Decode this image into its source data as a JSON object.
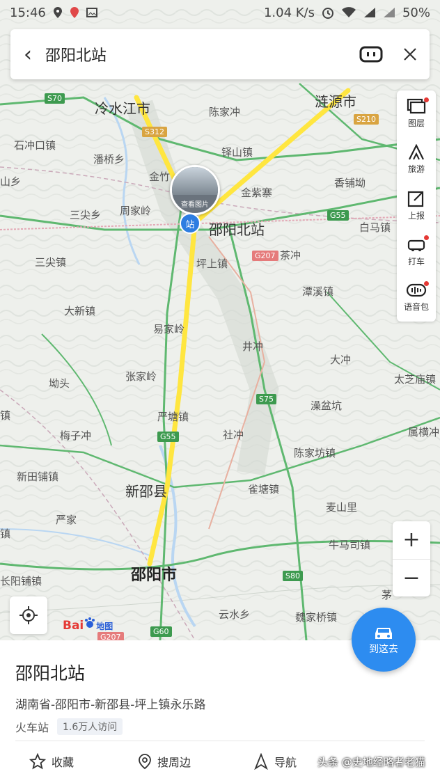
{
  "status_bar": {
    "time": "15:46",
    "net_speed": "1.04 K/s",
    "battery": "50%"
  },
  "search": {
    "title": "邵阳北站"
  },
  "map_labels": [
    {
      "id": "lengshuijiang",
      "text": "冷水江市",
      "cls": "big"
    },
    {
      "id": "lianyuan",
      "text": "涟源市",
      "cls": "big"
    },
    {
      "id": "chenjiachong",
      "text": "陈家冲",
      "cls": ""
    },
    {
      "id": "shichongkou",
      "text": "石冲口镇",
      "cls": ""
    },
    {
      "id": "panqiao",
      "text": "潘桥乡",
      "cls": ""
    },
    {
      "id": "dushanzhen",
      "text": "铎山镇",
      "cls": ""
    },
    {
      "id": "jinzhu",
      "text": "金竹",
      "cls": ""
    },
    {
      "id": "jinzizhai",
      "text": "金紫寨",
      "cls": ""
    },
    {
      "id": "xiangpuwu",
      "text": "香铺坳",
      "cls": ""
    },
    {
      "id": "xiang_left",
      "text": "山乡",
      "cls": ""
    },
    {
      "id": "sanjianxiang",
      "text": "三尖乡",
      "cls": ""
    },
    {
      "id": "zhoujialing",
      "text": "周家岭",
      "cls": ""
    },
    {
      "id": "shaoyangbei",
      "text": "邵阳北站",
      "cls": "big"
    },
    {
      "id": "baimazhen",
      "text": "白马镇",
      "cls": ""
    },
    {
      "id": "sanjianzhen",
      "text": "三尖镇",
      "cls": ""
    },
    {
      "id": "pingshangzhen",
      "text": "坪上镇",
      "cls": ""
    },
    {
      "id": "chachong",
      "text": "茶冲",
      "cls": ""
    },
    {
      "id": "tanxizhen",
      "text": "潭溪镇",
      "cls": ""
    },
    {
      "id": "daxinzhen",
      "text": "大新镇",
      "cls": ""
    },
    {
      "id": "yijialing",
      "text": "易家岭",
      "cls": ""
    },
    {
      "id": "jingchong",
      "text": "井冲",
      "cls": ""
    },
    {
      "id": "dachong",
      "text": "大冲",
      "cls": ""
    },
    {
      "id": "zhangjialing",
      "text": "张家岭",
      "cls": ""
    },
    {
      "id": "taizhimiao",
      "text": "太芝庙镇",
      "cls": ""
    },
    {
      "id": "aotou",
      "text": "坳头",
      "cls": ""
    },
    {
      "id": "zaoyikeng",
      "text": "澡盆坑",
      "cls": ""
    },
    {
      "id": "yanzhenzhen",
      "text": "严塘镇",
      "cls": ""
    },
    {
      "id": "meizichong",
      "text": "梅子冲",
      "cls": ""
    },
    {
      "id": "shechong",
      "text": "社冲",
      "cls": ""
    },
    {
      "id": "shuhengzhen",
      "text": "属横冲",
      "cls": ""
    },
    {
      "id": "chenjiafang",
      "text": "陈家坊镇",
      "cls": ""
    },
    {
      "id": "xintianpu",
      "text": "新田铺镇",
      "cls": ""
    },
    {
      "id": "xinshaoxian",
      "text": "新邵县",
      "cls": "big"
    },
    {
      "id": "quetangzhen",
      "text": "雀塘镇",
      "cls": ""
    },
    {
      "id": "maishanli",
      "text": "麦山里",
      "cls": ""
    },
    {
      "id": "yanjia",
      "text": "严家",
      "cls": ""
    },
    {
      "id": "niumaqiao",
      "text": "牛马司镇",
      "cls": ""
    },
    {
      "id": "shaoyangshi",
      "text": "邵阳市",
      "cls": "city"
    },
    {
      "id": "changyangpu",
      "text": "长阳铺镇",
      "cls": ""
    },
    {
      "id": "yunshuixiang",
      "text": "云水乡",
      "cls": ""
    },
    {
      "id": "weijiaqiao",
      "text": "魏家桥镇",
      "cls": ""
    },
    {
      "id": "mao",
      "text": "茅",
      "cls": ""
    },
    {
      "id": "zhen_left",
      "text": "镇",
      "cls": ""
    },
    {
      "id": "zhen_left2",
      "text": "镇",
      "cls": ""
    }
  ],
  "road_badges": [
    {
      "id": "s70",
      "text": "S70",
      "cls": "g"
    },
    {
      "id": "s312",
      "text": "S312",
      "cls": "s"
    },
    {
      "id": "s210",
      "text": "S210",
      "cls": "s"
    },
    {
      "id": "g55a",
      "text": "G55",
      "cls": "g"
    },
    {
      "id": "g207a",
      "text": "G207",
      "cls": "r"
    },
    {
      "id": "s75",
      "text": "S75",
      "cls": "g"
    },
    {
      "id": "g55b",
      "text": "G55",
      "cls": "g"
    },
    {
      "id": "s80",
      "text": "S80",
      "cls": "g"
    },
    {
      "id": "g60",
      "text": "G60",
      "cls": "g"
    },
    {
      "id": "g207b",
      "text": "G207",
      "cls": "r"
    }
  ],
  "station_pin": {
    "label": "查看图片"
  },
  "poi_icon": "站",
  "side_tools": [
    {
      "id": "layers",
      "label": "图层",
      "icon": "layers-icon",
      "dot": true
    },
    {
      "id": "travel",
      "label": "旅游",
      "icon": "travel-icon",
      "dot": false
    },
    {
      "id": "report",
      "label": "上报",
      "icon": "report-icon",
      "dot": false
    },
    {
      "id": "taxi",
      "label": "打车",
      "icon": "taxi-icon",
      "dot": true
    },
    {
      "id": "voice",
      "label": "语音包",
      "icon": "voice-pack-icon",
      "dot": true
    }
  ],
  "zoom": {
    "in": "+",
    "out": "−"
  },
  "logo": {
    "bai": "Bai",
    "du_icon": "du-paw-icon",
    "map_text": "地图"
  },
  "fab": {
    "label": "到这去"
  },
  "place": {
    "name": "邵阳北站",
    "address": "湖南省-邵阳市-新邵县-坪上镇永乐路",
    "category": "火车站",
    "visits": "1.6万人访问"
  },
  "actions": {
    "favorite": "收藏",
    "nearby": "搜周边",
    "navigate": "导航"
  },
  "watermark": "头条 @史地经略者老猫",
  "colors": {
    "accent": "#2d8cf0",
    "route": "#ffe640",
    "highway": "#3d9a4f"
  }
}
